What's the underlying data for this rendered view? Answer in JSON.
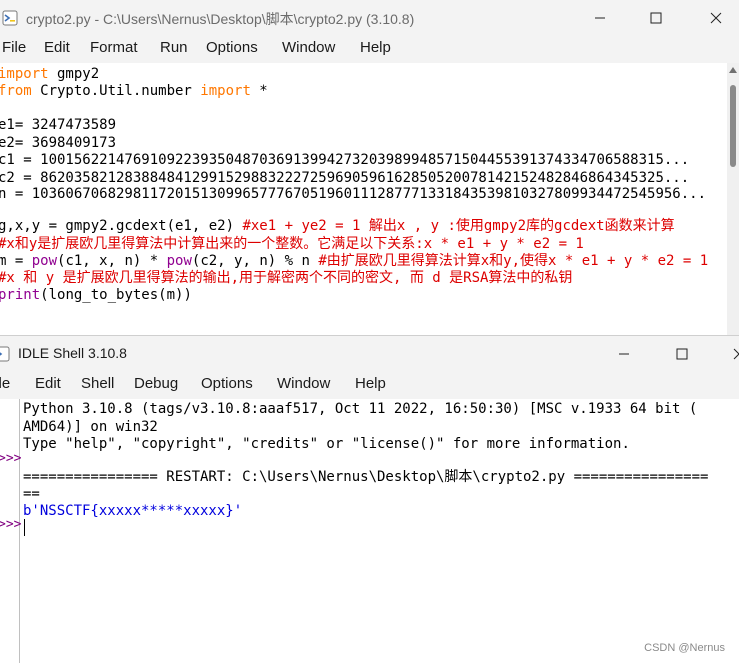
{
  "editor": {
    "title": "crypto2.py - C:\\Users\\Nernus\\Desktop\\脚本\\crypto2.py (3.10.8)",
    "controls": {
      "minimize": "─",
      "maximize": "☐",
      "close": "✕"
    },
    "menu": [
      "File",
      "Edit",
      "Format",
      "Run",
      "Options",
      "Window",
      "Help"
    ],
    "code": {
      "l1_kw": "import",
      "l1_rest": " gmpy2",
      "l2_kw1": "from",
      "l2_mid": " Crypto.Util.number ",
      "l2_kw2": "import",
      "l2_rest": " *",
      "l3": "e1= 3247473589",
      "l4": "e2= 3698409173",
      "l5": "c1 = 10015622147691092239350487036913994273203989948571504455391374334706588315...",
      "l6": "c2 = 86203582128388484129915298832227259690596162850520078142152482846864345325...",
      "l7": "n = 10360670682981172015130996577767051960111287771331843539810327809934472545956...",
      "l8_code": "g,x,y = gmpy2.gcdext(e1, e2) ",
      "l8_comment": "#xe1 + ye2 = 1 解出x , y :使用gmpy2库的gcdext函数来计算",
      "l9_comment": "#x和y是扩展欧几里得算法中计算出来的一个整数。它满足以下关系:x * e1 + y * e2 = 1",
      "l10_a": "m = ",
      "l10_pow1": "pow",
      "l10_b": "(c1, x, n) * ",
      "l10_pow2": "pow",
      "l10_c": "(c2, y, n) % n ",
      "l10_comment": "#由扩展欧几里得算法计算x和y,使得x * e1 + y * e2 = 1",
      "l11_comment": "#x 和 y 是扩展欧几里得算法的输出,用于解密两个不同的密文, 而 d 是RSA算法中的私钥",
      "l12_print": "print",
      "l12_rest": "(long_to_bytes(m))"
    }
  },
  "shell": {
    "title": "IDLE Shell 3.10.8",
    "controls": {
      "minimize": "─",
      "maximize": "☐",
      "close": "✕"
    },
    "menu": [
      "File",
      "Edit",
      "Shell",
      "Debug",
      "Options",
      "Window",
      "Help"
    ],
    "lines": {
      "l1": "Python 3.10.8 (tags/v3.10.8:aaaf517, Oct 11 2022, 16:50:30) [MSC v.1933 64 bit (",
      "l2": "AMD64)] on win32",
      "l3": "Type \"help\", \"copyright\", \"credits\" or \"license()\" for more information.",
      "l4": "================ RESTART: C:\\Users\\Nernus\\Desktop\\脚本\\crypto2.py ================",
      "l5": "==",
      "l6": "b'NSSCTF{xxxxx*****xxxxx}'"
    },
    "prompt": ">>>"
  },
  "watermark": "CSDN @Nernus"
}
